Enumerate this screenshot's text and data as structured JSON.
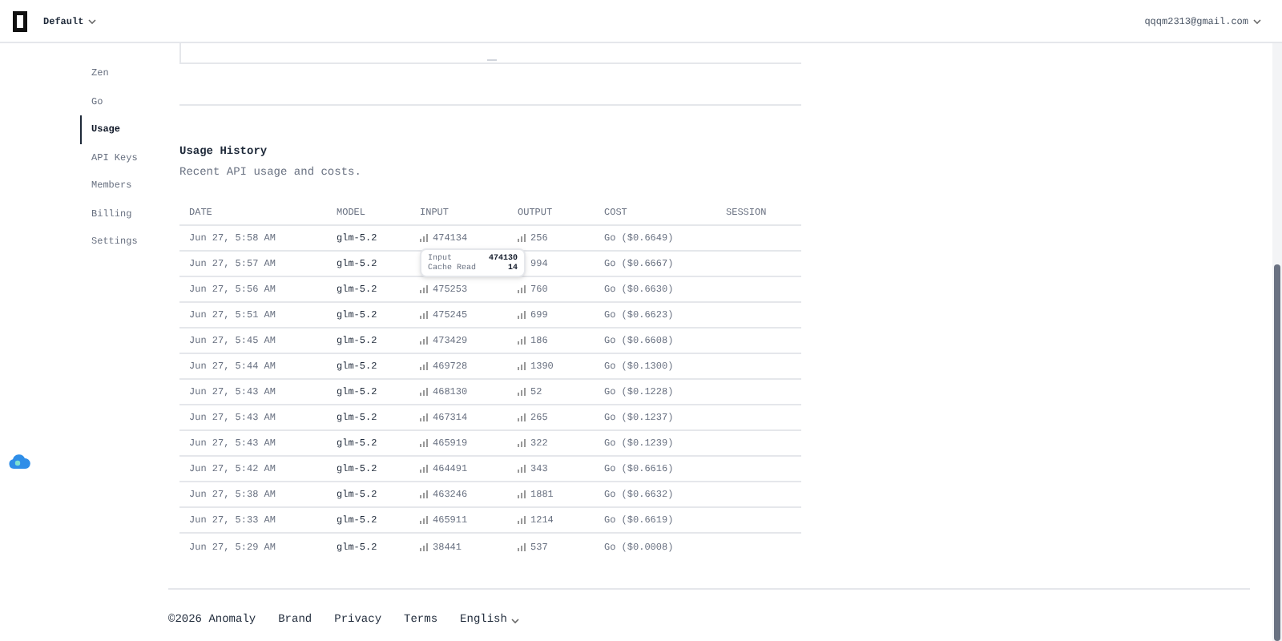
{
  "header": {
    "workspace": "Default",
    "user_email": "qqqm2313@gmail.com"
  },
  "sidebar": {
    "items": [
      {
        "label": "Zen",
        "selected": false
      },
      {
        "label": "Go",
        "selected": false
      },
      {
        "label": "Usage",
        "selected": true
      },
      {
        "label": "API Keys",
        "selected": false
      },
      {
        "label": "Members",
        "selected": false
      },
      {
        "label": "Billing",
        "selected": false
      },
      {
        "label": "Settings",
        "selected": false
      }
    ]
  },
  "usage_history": {
    "title": "Usage History",
    "subtitle": "Recent API usage and costs.",
    "columns": [
      "DATE",
      "MODEL",
      "INPUT",
      "OUTPUT",
      "COST",
      "SESSION"
    ],
    "rows": [
      {
        "date": "Jun 27, 5:58 AM",
        "model": "glm-5.2",
        "input": "474134",
        "output": "256",
        "cost": "Go ($0.6649)"
      },
      {
        "date": "Jun 27, 5:57 AM",
        "model": "glm-5.2",
        "output": "994",
        "cost": "Go ($0.6667)"
      },
      {
        "date": "Jun 27, 5:56 AM",
        "model": "glm-5.2",
        "input": "475253",
        "output": "760",
        "cost": "Go ($0.6630)"
      },
      {
        "date": "Jun 27, 5:51 AM",
        "model": "glm-5.2",
        "input": "475245",
        "output": "699",
        "cost": "Go ($0.6623)"
      },
      {
        "date": "Jun 27, 5:45 AM",
        "model": "glm-5.2",
        "input": "473429",
        "output": "186",
        "cost": "Go ($0.6608)"
      },
      {
        "date": "Jun 27, 5:44 AM",
        "model": "glm-5.2",
        "input": "469728",
        "output": "1390",
        "cost": "Go ($0.1300)"
      },
      {
        "date": "Jun 27, 5:43 AM",
        "model": "glm-5.2",
        "input": "468130",
        "output": "52",
        "cost": "Go ($0.1228)"
      },
      {
        "date": "Jun 27, 5:43 AM",
        "model": "glm-5.2",
        "input": "467314",
        "output": "265",
        "cost": "Go ($0.1237)"
      },
      {
        "date": "Jun 27, 5:43 AM",
        "model": "glm-5.2",
        "input": "465919",
        "output": "322",
        "cost": "Go ($0.1239)"
      },
      {
        "date": "Jun 27, 5:42 AM",
        "model": "glm-5.2",
        "input": "464491",
        "output": "343",
        "cost": "Go ($0.6616)"
      },
      {
        "date": "Jun 27, 5:38 AM",
        "model": "glm-5.2",
        "input": "463246",
        "output": "1881",
        "cost": "Go ($0.6632)"
      },
      {
        "date": "Jun 27, 5:33 AM",
        "model": "glm-5.2",
        "input": "465911",
        "output": "1214",
        "cost": "Go ($0.6619)"
      },
      {
        "date": "Jun 27, 5:29 AM",
        "model": "glm-5.2",
        "input": "38441",
        "output": "537",
        "cost": "Go ($0.0008)"
      }
    ],
    "tooltip": {
      "rows": [
        {
          "label": "Input",
          "value": "474130"
        },
        {
          "label": "Cache Read",
          "value": "14"
        }
      ]
    }
  },
  "footer": {
    "copyright": "©2026 Anomaly",
    "links": [
      "Brand",
      "Privacy",
      "Terms"
    ],
    "language": "English"
  }
}
